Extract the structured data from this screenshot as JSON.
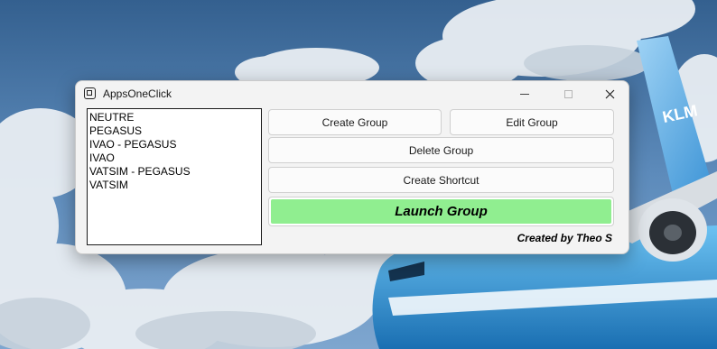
{
  "window": {
    "title": "AppsOneClick"
  },
  "groups": [
    "NEUTRE",
    "PEGASUS",
    "IVAO - PEGASUS",
    "IVAO",
    "VATSIM - PEGASUS",
    "VATSIM"
  ],
  "buttons": {
    "create": "Create Group",
    "edit": "Edit Group",
    "delete": "Delete Group",
    "shortcut": "Create Shortcut",
    "launch": "Launch Group"
  },
  "credit": "Created by Theo S",
  "wallpaper": {
    "tail_text": "KLM"
  },
  "colors": {
    "launch_button": "#90ee90",
    "window_bg": "#f3f3f3"
  },
  "icons": {
    "app": "app-window-icon",
    "minimize": "minimize-icon",
    "maximize": "maximize-icon",
    "close": "close-icon"
  }
}
